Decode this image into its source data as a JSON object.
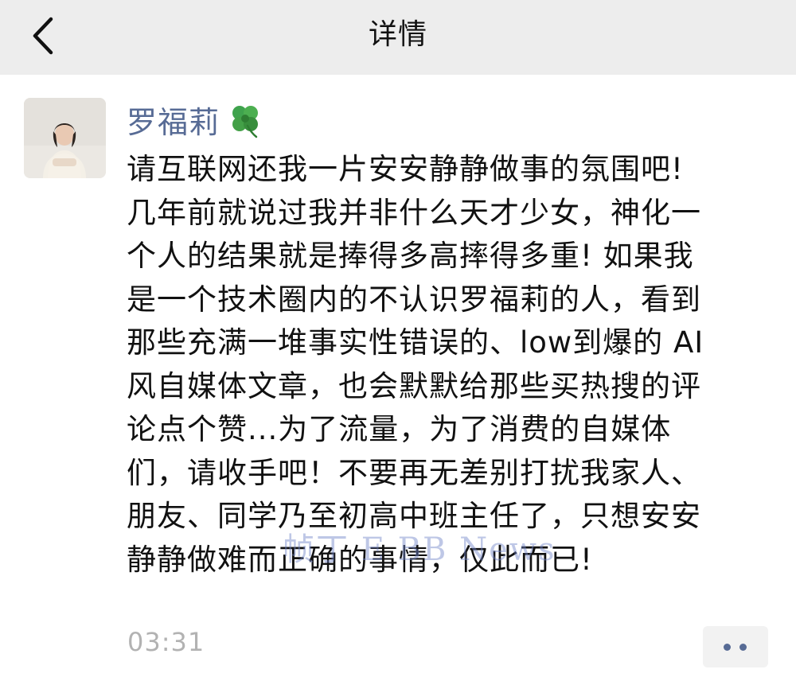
{
  "header": {
    "title": "详情"
  },
  "post": {
    "author": "罗福莉",
    "content_lines": [
      "请互联网还我一片安安静静做事的氛围吧!",
      "几年前就说过我并非什么天才少女，神化一",
      "个人的结果就是捧得多高摔得多重! 如果我",
      "是一个技术圈内的不认识罗福莉的人，看到",
      "那些充满一堆事实性错误的、low到爆的 AI",
      "风自媒体文章，也会默默给那些买热搜的评",
      "论点个赞...为了流量，为了消费的自媒体",
      "们，请收手吧！不要再无差别打扰我家人、",
      "朋友、同学乃至初高中班主任了，只想安安",
      "静静做难而正确的事情，仅此而已!"
    ],
    "time": "03:31",
    "watermark": "帧丁 E BB News"
  },
  "icons": {
    "back": "chevron-left-icon",
    "clover": "four-leaf-clover-icon",
    "more": "more-dots-icon"
  },
  "colors": {
    "nav_bg": "#ededed",
    "author_link": "#576b95",
    "timestamp": "#b2b2b2"
  }
}
